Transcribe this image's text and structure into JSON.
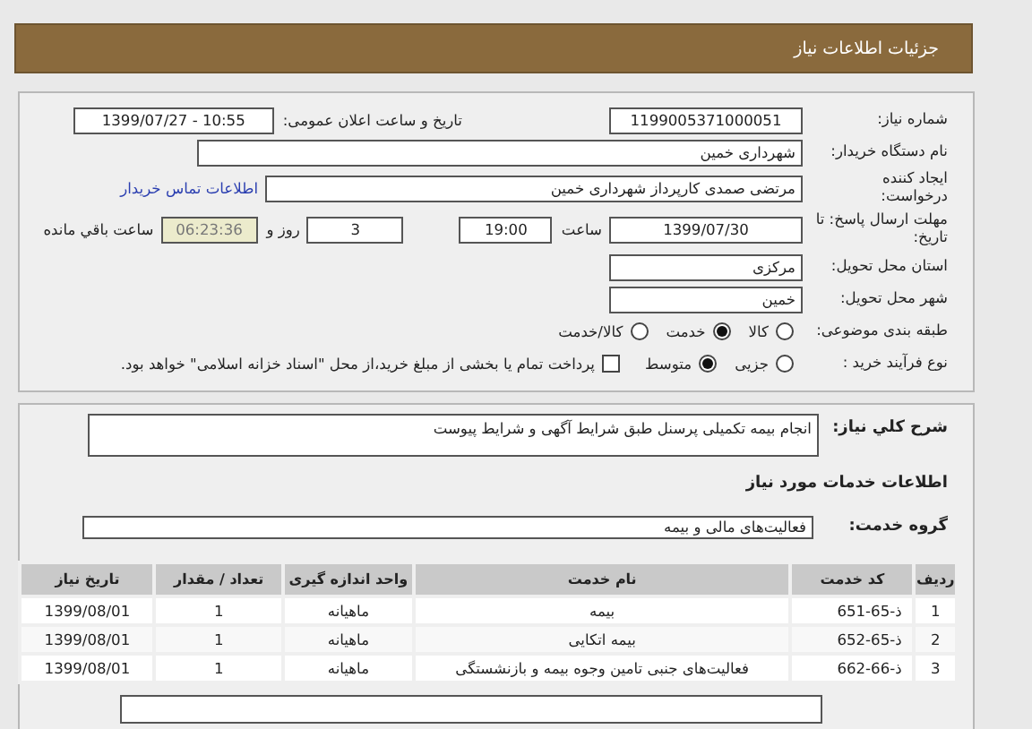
{
  "header": {
    "title": "جزئیات اطلاعات نیاز"
  },
  "need_number": {
    "label": "شماره نیاز:",
    "value": "1199005371000051"
  },
  "announce_datetime": {
    "label": "تاریخ و ساعت اعلان عمومی:",
    "value": "1399/07/27 - 10:55"
  },
  "buyer_org": {
    "label": "نام دستگاه خریدار:",
    "value": "شهرداری خمین"
  },
  "requester": {
    "label": "ایجاد کننده درخواست:",
    "value": "مرتضی صمدی کارپرداز شهرداری خمین",
    "link": "اطلاعات تماس خریدار"
  },
  "deadline": {
    "label": "مهلت ارسال پاسخ: تا تاریخ:",
    "date": "1399/07/30",
    "time_label": "ساعت",
    "time": "19:00",
    "days": "3",
    "days_label": "روز و",
    "remaining": "06:23:36",
    "remaining_label": "ساعت باقي مانده"
  },
  "province": {
    "label": "استان محل تحویل:",
    "value": "مرکزی"
  },
  "city": {
    "label": "شهر محل تحویل:",
    "value": "خمین"
  },
  "category": {
    "label": "طبقه بندی موضوعی:",
    "options": [
      {
        "label": "کالا",
        "selected": false
      },
      {
        "label": "خدمت",
        "selected": true
      },
      {
        "label": "کالا/خدمت",
        "selected": false
      }
    ]
  },
  "purchase_type": {
    "label": "نوع فرآیند خرید :",
    "options": [
      {
        "label": "جزیی",
        "selected": false
      },
      {
        "label": "متوسط",
        "selected": true
      }
    ],
    "treasury": {
      "label": "پرداخت تمام یا بخشی از مبلغ خرید،از محل \"اسناد خزانه اسلامی\" خواهد بود.",
      "checked": false
    }
  },
  "description": {
    "label": "شرح کلي نياز:",
    "value": "انجام بیمه تکمیلی پرسنل طبق شرایط آگهی و شرایط پیوست"
  },
  "services_heading": "اطلاعات خدمات مورد نیاز",
  "service_group": {
    "label": "گروه خدمت:",
    "value": "فعالیت‌های مالی و بیمه"
  },
  "table": {
    "columns": [
      "ردیف",
      "کد خدمت",
      "نام خدمت",
      "واحد اندازه گیری",
      "تعداد / مقدار",
      "تاریخ نیاز"
    ],
    "rows": [
      [
        "1",
        "ذ-65-651",
        "بیمه",
        "ماهیانه",
        "1",
        "1399/08/01"
      ],
      [
        "2",
        "ذ-65-652",
        "بیمه اتکایی",
        "ماهیانه",
        "1",
        "1399/08/01"
      ],
      [
        "3",
        "ذ-66-662",
        "فعالیت‌های جنبی تامین وجوه بیمه و بازنشستگی",
        "ماهیانه",
        "1",
        "1399/08/01"
      ]
    ]
  }
}
